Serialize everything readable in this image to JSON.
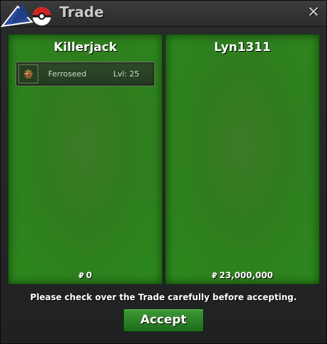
{
  "window": {
    "title": "Trade",
    "close_icon": "close-icon",
    "logo_icon": "pokeball-logo-icon"
  },
  "left_player": {
    "name": "Killerjack",
    "items": [
      {
        "icon": "ferroseed-sprite-icon",
        "name": "Ferroseed",
        "level": "Lvl: 25"
      }
    ],
    "money": "0",
    "currency_icon": "pokedollar-icon"
  },
  "right_player": {
    "name": "Lyn1311",
    "items": [],
    "money": "23,000,000",
    "currency_icon": "pokedollar-icon"
  },
  "notice": "Please check over the Trade carefully before accepting.",
  "accept_label": "Accept",
  "colors": {
    "panel_green": "#2f7b1f",
    "button_green": "#2f8a28",
    "window_bg": "#2a2b2c",
    "title_text": "#c9c9c9"
  }
}
